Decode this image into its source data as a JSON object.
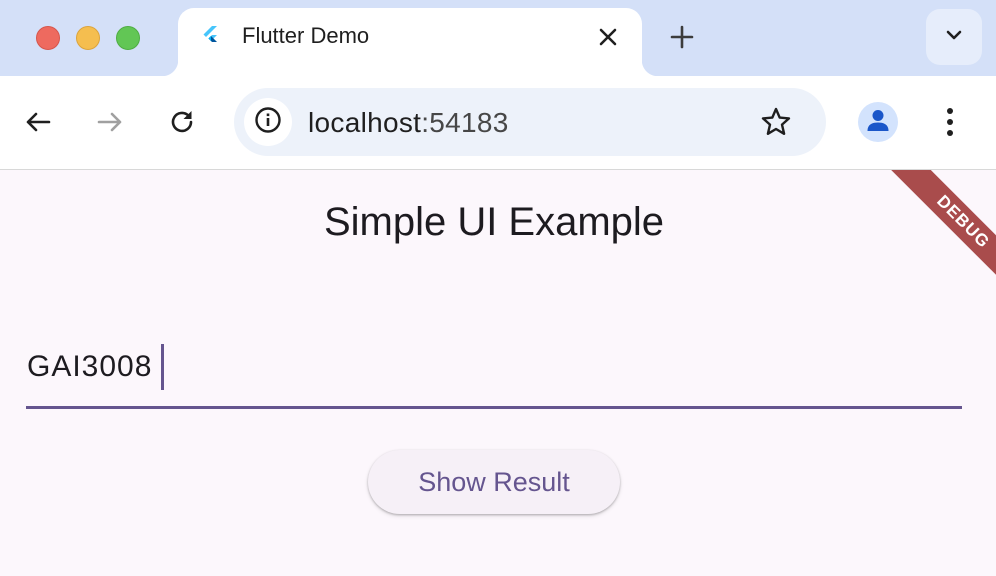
{
  "browser": {
    "tab": {
      "title": "Flutter Demo"
    },
    "address_bar": {
      "host": "localhost",
      "port": ":54183"
    },
    "icons": {
      "favicon": "flutter-logo-icon",
      "close": "close-icon",
      "new_tab": "plus-icon",
      "tab_search": "chevron-down-icon",
      "back": "arrow-left-icon",
      "forward": "arrow-right-icon",
      "reload": "reload-icon",
      "site_info": "info-icon",
      "bookmark": "star-icon",
      "profile": "person-icon",
      "menu": "more-vert-icon"
    }
  },
  "app": {
    "title": "Simple UI Example",
    "input": {
      "value": "GAI3008"
    },
    "button": {
      "label": "Show Result"
    },
    "debug_banner": "DEBUG"
  },
  "colors": {
    "primary": "#65558f",
    "background": "#fcf7fc",
    "debug_banner": "#a94c4c",
    "tab_strip": "#d4e0f8"
  }
}
